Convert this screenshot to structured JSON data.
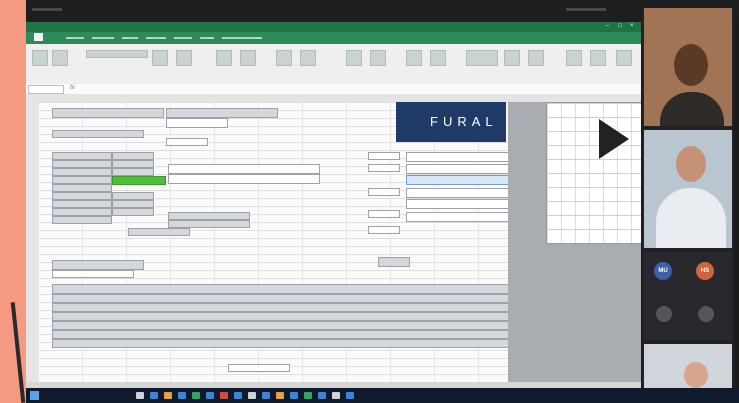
{
  "brand": {
    "logo_text": "FURAL",
    "logo_color": "#1f3a67",
    "accent": "#217346"
  },
  "excel": {
    "ribbon_title": "",
    "tabs": [],
    "name_box": "",
    "formula": "fx",
    "sheet_tab": ""
  },
  "teams": {
    "participants": [
      {
        "initials": "MU",
        "kind": "avatar"
      },
      {
        "initials": "HS",
        "kind": "avatar"
      }
    ]
  },
  "taskbar": {
    "clock": ""
  }
}
